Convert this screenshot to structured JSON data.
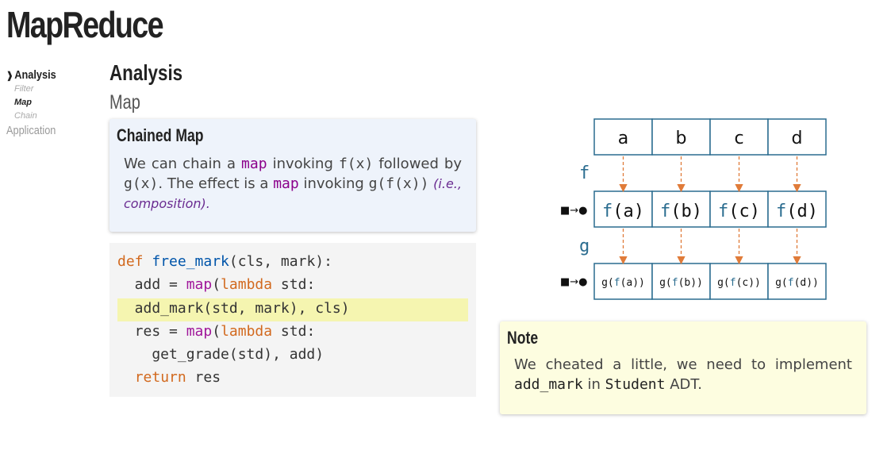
{
  "title": "MapReduce",
  "nav": {
    "items": [
      {
        "label": "Analysis",
        "current": true
      },
      {
        "label": "Application",
        "current": false
      }
    ],
    "subitems": [
      "Filter",
      "Map",
      "Chain"
    ]
  },
  "section_title": "Analysis",
  "subsection_title": "Map",
  "chained_box": {
    "title": "Chained Map",
    "text_1": "We can chain a",
    "code_map": "map",
    "text_2": "invoking",
    "code_fx": "f(x)",
    "text_3": "followed by",
    "code_gx": "g(x)",
    "text_4": ". The effect is a",
    "text_5": "invoking",
    "code_gfx": "g(f(x))",
    "italic": "(i.e., composition)",
    "text_end": "."
  },
  "code": {
    "line1": {
      "kw": "def",
      "fn": "free_mark",
      "rest": "(cls, mark):"
    },
    "line2": {
      "pre": "  add = ",
      "bi": "map",
      "p1": "(",
      "kw": "lambda",
      "rest": " std:"
    },
    "line3": {
      "text": "  add_mark(std, mark), cls)"
    },
    "line4": {
      "pre": "  res = ",
      "bi": "map",
      "p1": "(",
      "kw": "lambda",
      "rest": " std:"
    },
    "line5": {
      "text": "    get_grade(std), add)"
    },
    "line6": {
      "kw": "return",
      "rest": " res"
    }
  },
  "note_box": {
    "title": "Note",
    "text_1": "We cheated a little, we need to implement",
    "code_add_mark": "add_mark",
    "text_2": "in",
    "code_student": "Student",
    "text_3": "ADT."
  },
  "diagram": {
    "inputs": [
      "a",
      "b",
      "c",
      "d"
    ],
    "f_label": "f",
    "g_label": "g",
    "pointer": "■→●",
    "f_outputs": [
      {
        "fn": "f",
        "arg": "(a)"
      },
      {
        "fn": "f",
        "arg": "(b)"
      },
      {
        "fn": "f",
        "arg": "(c)"
      },
      {
        "fn": "f",
        "arg": "(d)"
      }
    ],
    "g_outputs": [
      {
        "pre": "g(",
        "fn": "f",
        "arg": "(a))"
      },
      {
        "pre": "g(",
        "fn": "f",
        "arg": "(b))"
      },
      {
        "pre": "g(",
        "fn": "f",
        "arg": "(c))"
      },
      {
        "pre": "g(",
        "fn": "f",
        "arg": "(d))"
      }
    ],
    "colors": {
      "border": "#2a6c8f",
      "arrow": "#e07b39",
      "fn": "#2a6c8f"
    }
  }
}
